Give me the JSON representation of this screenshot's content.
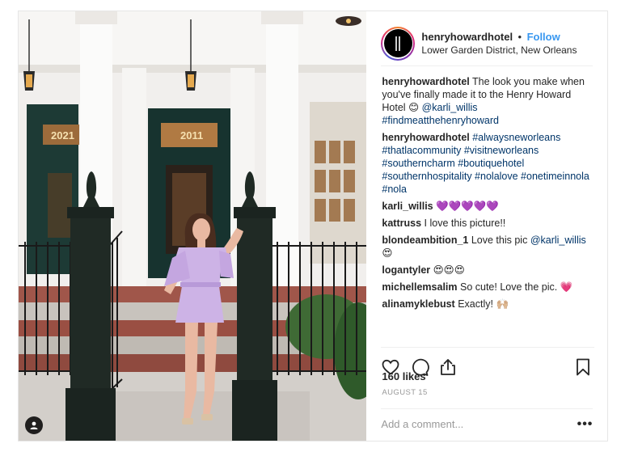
{
  "header": {
    "username": "henryhowardhotel",
    "separator": "•",
    "follow_label": "Follow",
    "location": "Lower Garden District, New Orleans"
  },
  "caption": {
    "username": "henryhowardhotel",
    "text": "The look you make when you've finally made it to the Henry Howard Hotel",
    "emoji": "😊",
    "mention": "@karli_willis",
    "hashtag": "#findmeatthehenryhoward"
  },
  "hashtag_comment": {
    "username": "henryhowardhotel",
    "text": "#alwaysneworleans #thatlacommunity #visitneworleans #southerncharm #boutiquehotel #southernhospitality #nolalove #onetimeinnola #nola"
  },
  "comments": [
    {
      "username": "karli_willis",
      "text": "💜💜💜💜💜"
    },
    {
      "username": "kattruss",
      "text": "I love this picture!!"
    },
    {
      "username": "blondeambition_1",
      "text": "Love this pic",
      "mention": "@karli_willis",
      "emoji": "😍"
    },
    {
      "username": "logantyler",
      "text": "😍😍😍"
    },
    {
      "username": "michellemsalim",
      "text": "So cute! Love the pic.",
      "emoji": "💗"
    },
    {
      "username": "alinamyklebust",
      "text": "Exactly!",
      "emoji": "🙌🏼"
    }
  ],
  "photo": {
    "door_number_left": "2021",
    "door_number_right": "2011"
  },
  "icons": {
    "like": "heart-icon",
    "comment": "comment-bubble-icon",
    "share": "share-icon",
    "save": "bookmark-icon",
    "tag": "user-tag-icon",
    "more": "more-options-icon"
  },
  "likes_text": "160 likes",
  "date": "AUGUST 15",
  "add_comment": {
    "placeholder": "Add a comment..."
  },
  "more_label": "•••",
  "colors": {
    "accent": "#3897f0",
    "hashtag": "#003569",
    "muted": "#999999"
  }
}
